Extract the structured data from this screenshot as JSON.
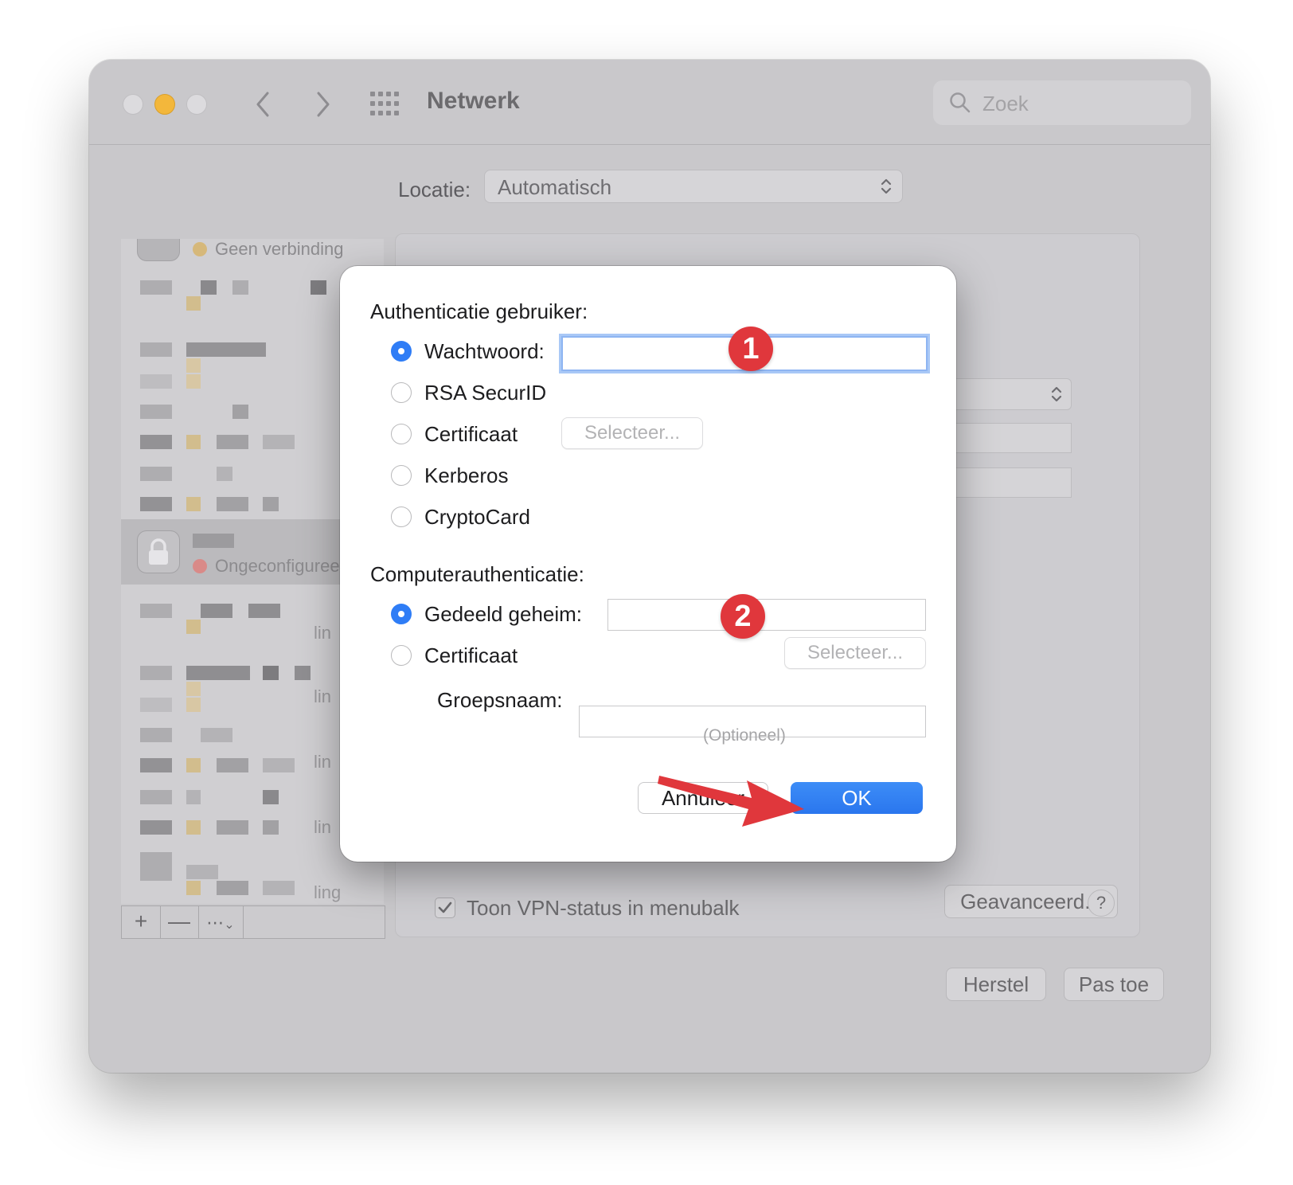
{
  "window": {
    "title": "Netwerk",
    "search_placeholder": "Zoek",
    "location_label": "Locatie:",
    "location_value": "Automatisch"
  },
  "sidebar": {
    "items": [
      {
        "status": "Geen verbinding",
        "status_color": "#d6b87a"
      },
      {
        "status": "Ongeconfigureerd",
        "status_color": "#d98a88",
        "selected": true
      }
    ],
    "partial_texts": [
      "lin",
      "lin",
      "lin",
      "lin",
      "ling"
    ],
    "tool_add": "+",
    "tool_remove": "—",
    "tool_more": "⋯"
  },
  "main": {
    "vpn_status_label": "Toon VPN-status in menubalk",
    "vpn_status_checked": true,
    "advanced_button": "Geavanceerd...",
    "help_button": "?",
    "revert_button": "Herstel",
    "apply_button": "Pas toe"
  },
  "dialog": {
    "user_auth_heading": "Authenticatie gebruiker:",
    "user_auth_options": [
      {
        "label": "Wachtwoord:",
        "checked": true
      },
      {
        "label": "RSA SecurID",
        "checked": false
      },
      {
        "label": "Certificaat",
        "checked": false
      },
      {
        "label": "Kerberos",
        "checked": false
      },
      {
        "label": "CryptoCard",
        "checked": false
      }
    ],
    "password_value": "",
    "select_button_user": "Selecteer...",
    "computer_auth_heading": "Computerauthenticatie:",
    "computer_auth_options": [
      {
        "label": "Gedeeld geheim:",
        "checked": true
      },
      {
        "label": "Certificaat",
        "checked": false
      }
    ],
    "shared_secret_value": "",
    "select_button_computer": "Selecteer...",
    "group_name_label": "Groepsnaam:",
    "group_name_value": "",
    "group_name_hint": "(Optioneel)",
    "cancel_button": "Annuleer",
    "ok_button": "OK"
  },
  "annotations": {
    "badge_1": "1",
    "badge_2": "2",
    "arrow_color": "#e0373c"
  },
  "colors": {
    "accent": "#2f7df6",
    "badge": "#e0373c"
  }
}
